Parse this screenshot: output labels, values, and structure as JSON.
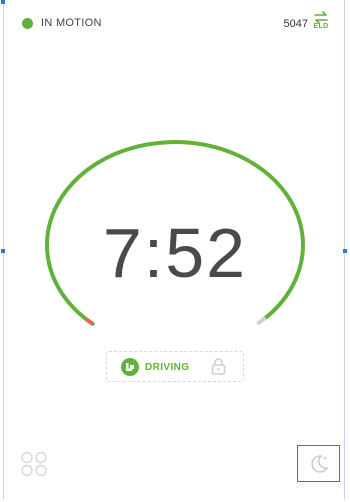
{
  "status": {
    "label": "IN MOTION",
    "color": "#62b13a"
  },
  "header": {
    "vehicle_number": "5047",
    "eld_label": "ELD",
    "eld_icon": "swap-arrows-icon"
  },
  "timer": {
    "value": "7:52",
    "progress": 0.82,
    "arc_color": "#62b13a",
    "start_color": "#e06a4e",
    "end_color": "#d0d0d0"
  },
  "duty": {
    "label": "DRIVING",
    "icon": "driving-status-icon",
    "lock_icon": "lock-icon"
  },
  "footer": {
    "menu_icon": "grid-menu-icon",
    "night_mode_icon": "moon-icon",
    "highlight_color": "#d9403d"
  }
}
